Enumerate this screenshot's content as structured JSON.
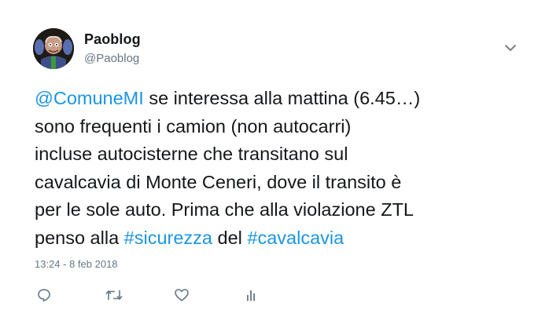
{
  "author": {
    "display_name": "Paoblog",
    "handle": "@Paoblog"
  },
  "tweet": {
    "lines": [
      [
        {
          "text": "@ComuneMI",
          "link": true
        },
        {
          "text": " se interessa alla mattina (6.45…)",
          "link": false
        }
      ],
      [
        {
          "text": "sono frequenti i camion (non autocarri)",
          "link": false
        }
      ],
      [
        {
          "text": "incluse autocisterne che transitano sul",
          "link": false
        }
      ],
      [
        {
          "text": "cavalcavia di Monte Ceneri, dove il transito è",
          "link": false
        }
      ],
      [
        {
          "text": "per le sole auto. Prima che alla violazione ZTL",
          "link": false
        }
      ],
      [
        {
          "text": "penso alla ",
          "link": false
        },
        {
          "text": "#sicurezza",
          "link": true
        },
        {
          "text": " del ",
          "link": false
        },
        {
          "text": "#cavalcavia",
          "link": true
        }
      ]
    ],
    "timestamp": "13:24 - 8 feb 2018"
  },
  "actions": [
    "reply-icon",
    "retweet-icon",
    "like-icon",
    "analytics-icon"
  ],
  "colors": {
    "link": "#1b95e0",
    "text": "#14171a",
    "muted": "#657786"
  }
}
